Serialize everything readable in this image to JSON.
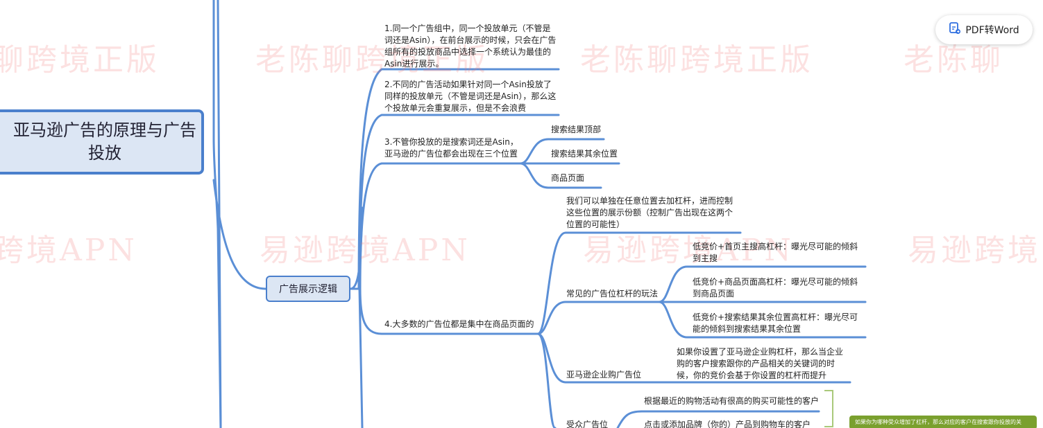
{
  "watermarks": {
    "row1": [
      "聊跨境正版",
      "老陈聊跨境正版",
      "老陈聊跨境正版",
      "老陈聊"
    ],
    "row2": [
      "跨境APN",
      "易逊跨境APN",
      "易逊跨境APN",
      "易逊跨境"
    ]
  },
  "pdf_button": {
    "label": "PDF转Word",
    "icon": "pdf-convert-icon"
  },
  "mindmap": {
    "root": "亚马逊广告的原理与广告投放",
    "branch": "广告展示逻辑",
    "points": {
      "p1": "1.同一个广告组中，同一个投放单元（不管是词还是Asin），在前台展示的时候，只会在广告组所有的投放商品中选择一个系统认为最佳的Asin进行展示。",
      "p2": "2.不同的广告活动如果针对同一个Asin投放了同样的投放单元（不管是词还是Asin），那么这个投放单元会重复展示，但是不会浪费",
      "p3": "3.不管你投放的是搜索词还是Asin，亚马逊的广告位都会出现在三个位置",
      "p3_children": [
        "搜索结果顶部",
        "搜索结果其余位置",
        "商品页面"
      ],
      "p4": "4.大多数的广告位都是集中在商品页面的",
      "p4_note": "我们可以单独在任意位置去加杠杆，进而控制这些位置的展示份额（控制广告出现在这两个位置的可能性）",
      "p4_common": "常见的广告位杠杆的玩法",
      "p4_common_children": [
        "低竞价+首页主搜高杠杆：曝光尽可能的倾斜到主搜",
        "低竞价+商品页面高杠杆：曝光尽可能的倾斜到商品页面",
        "低竞价+搜索结果其余位置高杠杆：曝光尽可能的倾斜到搜索结果其余位置"
      ],
      "p4_business": "亚马逊企业购广告位",
      "p4_business_child": "如果你设置了亚马逊企业购杠杆，那么当企业购的客户搜索跟你的产品相关的关键词的时候，你的竞价会基于你设置的杠杆而提升",
      "p4_audience": "受众广告位",
      "p4_audience_children": [
        "根据最近的购物活动有很高的购买可能性的客户",
        "点击或添加品牌（你的）产品到购物车的客户"
      ],
      "p4_audience_note": "如果你为哪种受众增加了杠杆，那么对应的客户在搜索跟你投放的关"
    }
  },
  "colors": {
    "line": "#5b8fd6",
    "root_bg": "#dce6f4",
    "root_border": "#4a7fcc",
    "note_bg": "#7aa02e",
    "watermark": "#f07878"
  }
}
